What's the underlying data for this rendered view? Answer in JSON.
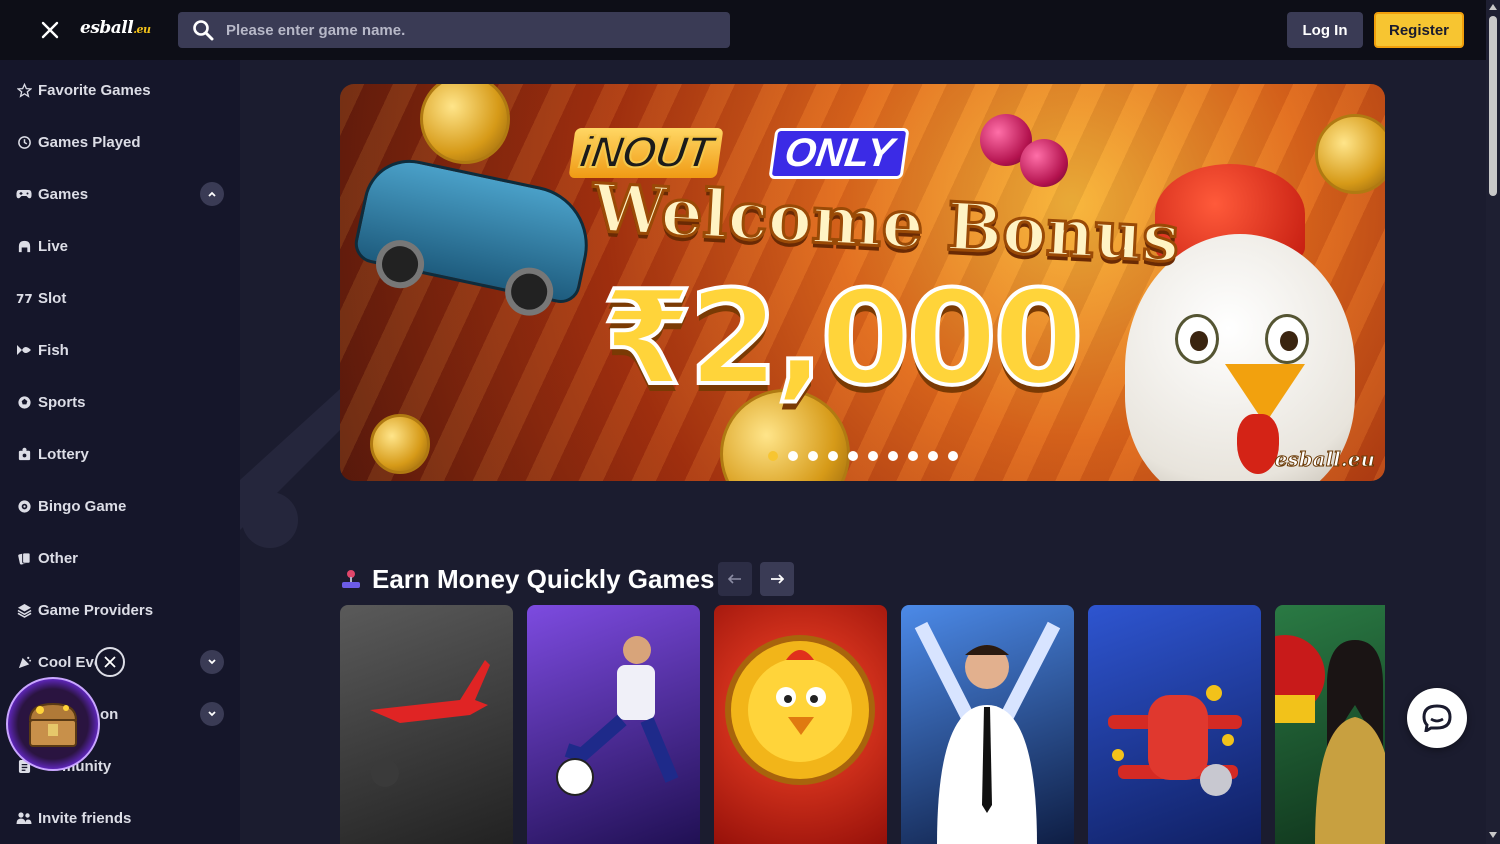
{
  "header": {
    "logo_text": "esball",
    "logo_suffix": ".eu",
    "search_placeholder": "Please enter game name.",
    "login_label": "Log In",
    "register_label": "Register"
  },
  "sidebar": {
    "items": [
      {
        "label": "Favorite Games",
        "icon": "star-icon"
      },
      {
        "label": "Games Played",
        "icon": "history-icon"
      },
      {
        "label": "Games",
        "icon": "gamepad-icon",
        "chevron": "up"
      },
      {
        "label": "Live",
        "icon": "live-dealer-icon"
      },
      {
        "label": "Slot",
        "icon": "slot-icon"
      },
      {
        "label": "Fish",
        "icon": "fish-icon"
      },
      {
        "label": "Sports",
        "icon": "sports-ball-icon"
      },
      {
        "label": "Lottery",
        "icon": "lottery-icon"
      },
      {
        "label": "Bingo Game",
        "icon": "bingo-icon"
      },
      {
        "label": "Other",
        "icon": "cards-icon"
      },
      {
        "label": "Game Providers",
        "icon": "providers-icon"
      },
      {
        "label": "Cool Eve",
        "icon": "party-icon",
        "chevron": "down"
      },
      {
        "label": "on",
        "icon": "promotion-icon",
        "chevron": "down"
      },
      {
        "label": "munity",
        "icon": "community-icon"
      },
      {
        "label": "Invite friends",
        "icon": "invite-icon"
      }
    ]
  },
  "banner": {
    "tag_inout": "iNOUT",
    "tag_only": "ONLY",
    "headline": "Welcome Bonus",
    "amount": "₹2,000",
    "brand_mark": "esball.eu",
    "slide_count": 10,
    "active_slide": 1
  },
  "section": {
    "title": "Earn Money Quickly Games",
    "prev_label": "←",
    "next_label": "→",
    "cards": [
      {
        "name": "aviator-card",
        "colors": [
          "#4a4a4a",
          "#222222"
        ]
      },
      {
        "name": "soccer-card",
        "colors": [
          "#6a3cc8",
          "#1e0e4e"
        ]
      },
      {
        "name": "chicken-card",
        "colors": [
          "#e0301c",
          "#7a0a06"
        ]
      },
      {
        "name": "live-dealer-card",
        "colors": [
          "#3a6ed8",
          "#0d1c44"
        ]
      },
      {
        "name": "plane-card",
        "colors": [
          "#2a4ab8",
          "#101e5a"
        ]
      },
      {
        "name": "crazy-time-card",
        "colors": [
          "#1e6a3a",
          "#0a2a16"
        ]
      }
    ]
  },
  "colors": {
    "accent": "#f7c531",
    "bg": "#1b1c2f",
    "sidebar": "#15162a",
    "topbar": "#0d0e17"
  }
}
